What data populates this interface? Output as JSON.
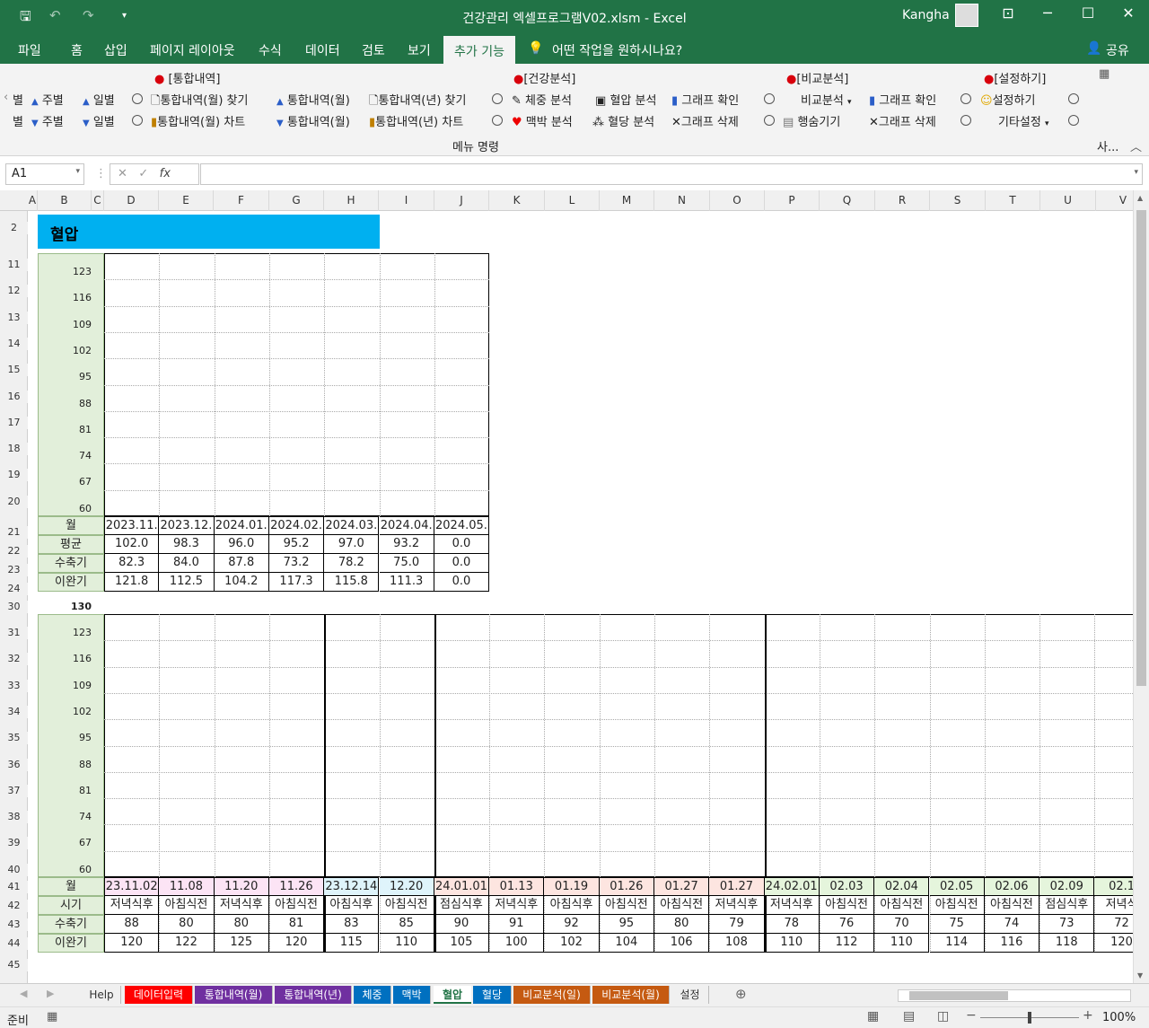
{
  "window": {
    "title": "건강관리 엑셀프로그램V02.xlsm  -  Excel",
    "user": "Kangha"
  },
  "ribbon_tabs": [
    "파일",
    "홈",
    "삽입",
    "페이지 레이아웃",
    "수식",
    "데이터",
    "검토",
    "보기",
    "추가 기능"
  ],
  "tell_me": "어떤 작업을 원하시나요?",
  "share": "공유",
  "groups": {
    "total": {
      "title": "[통합내역]",
      "week_up": "주별",
      "day_up": "일별",
      "week_dn": "주별",
      "day_dn": "일별",
      "find_month": "통합내역(월) 찾기",
      "chart_month": "통합내역(월) 차트",
      "month_up": "통합내역(월)",
      "month_dn": "통합내역(월)",
      "find_year": "통합내역(년) 찾기",
      "chart_year": "통합내역(년) 차트",
      "left_up": "별",
      "left_dn": "별"
    },
    "health": {
      "title": "[건강분석]",
      "weight": "체중 분석",
      "pulse": "맥박 분석",
      "bp": "혈압 분석",
      "sugar": "혈당 분석",
      "graph_check": "그래프 확인",
      "graph_delete": "그래프 삭제"
    },
    "compare": {
      "title": "[비교분석]",
      "compare": "비교분석",
      "hide_rows": "행숨기기",
      "graph_check": "그래프 확인",
      "graph_delete": "그래프 삭제"
    },
    "settings": {
      "title": "[설정하기]",
      "settings": "설정하기",
      "other": "기타설정"
    },
    "menu_label": "메뉴 명령",
    "collapsed": "사..."
  },
  "namebox": "A1",
  "fx": "fx",
  "columns": [
    "A",
    "B",
    "C",
    "D",
    "E",
    "F",
    "G",
    "H",
    "I",
    "J",
    "K",
    "L",
    "M",
    "N",
    "O",
    "P",
    "Q",
    "R",
    "S",
    "T",
    "U",
    "V"
  ],
  "rows": {
    "top": [
      "2",
      "11",
      "12",
      "13",
      "14",
      "15",
      "16",
      "17",
      "18",
      "19",
      "20",
      "21",
      "22",
      "23",
      "24"
    ],
    "bottom": [
      "30",
      "31",
      "32",
      "33",
      "34",
      "35",
      "36",
      "37",
      "38",
      "39",
      "40",
      "41",
      "42",
      "43",
      "44",
      "45"
    ]
  },
  "bp_title": "혈압",
  "y_axis_top": [
    "123",
    "116",
    "109",
    "102",
    "95",
    "88",
    "81",
    "74",
    "67",
    "60"
  ],
  "y_axis_bottom_header": "130",
  "y_axis_bottom": [
    "123",
    "116",
    "109",
    "102",
    "95",
    "88",
    "81",
    "74",
    "67",
    "60"
  ],
  "monthly": {
    "labels": [
      "월",
      "평균",
      "수축기",
      "이완기"
    ],
    "months": [
      "2023.11.",
      "2023.12.",
      "2024.01.",
      "2024.02.",
      "2024.03.",
      "2024.04.",
      "2024.05."
    ],
    "avg": [
      "102.0",
      "98.3",
      "96.0",
      "95.2",
      "97.0",
      "93.2",
      "0.0"
    ],
    "systolic": [
      "82.3",
      "84.0",
      "87.8",
      "73.2",
      "78.2",
      "75.0",
      "0.0"
    ],
    "diastolic": [
      "121.8",
      "112.5",
      "104.2",
      "117.3",
      "115.8",
      "111.3",
      "0.0"
    ]
  },
  "daily": {
    "labels": [
      "월",
      "시기",
      "수축기",
      "이완기"
    ],
    "dates": [
      "23.11.02",
      "11.08",
      "11.20",
      "11.26",
      "23.12.14",
      "12.20",
      "24.01.01",
      "01.13",
      "01.19",
      "01.26",
      "01.27",
      "01.27",
      "24.02.01",
      "02.03",
      "02.04",
      "02.05",
      "02.06",
      "02.09",
      "02.1"
    ],
    "times": [
      "저녁식후",
      "아침식전",
      "저녁식후",
      "아침식전",
      "아침식후",
      "아침식전",
      "점심식후",
      "저녁식후",
      "아침식후",
      "아침식전",
      "아침식전",
      "저녁식후",
      "저녁식후",
      "아침식전",
      "아침식전",
      "아침식전",
      "아침식전",
      "점심식후",
      "저녁식"
    ],
    "systolic": [
      "88",
      "80",
      "80",
      "81",
      "83",
      "85",
      "90",
      "91",
      "92",
      "95",
      "80",
      "79",
      "78",
      "76",
      "70",
      "75",
      "74",
      "73",
      "72"
    ],
    "diastolic": [
      "120",
      "122",
      "125",
      "120",
      "115",
      "110",
      "105",
      "100",
      "102",
      "104",
      "106",
      "108",
      "110",
      "112",
      "110",
      "114",
      "116",
      "118",
      "120"
    ]
  },
  "date_colors": [
    "#fce4f5",
    "#fce4f5",
    "#fce4f5",
    "#fce4f5",
    "#dff4fb",
    "#dff4fb",
    "#fde5e0",
    "#fde5e0",
    "#fde5e0",
    "#fde5e0",
    "#fde5e0",
    "#fde5e0",
    "#e5f5dc",
    "#e5f5dc",
    "#e5f5dc",
    "#e5f5dc",
    "#e5f5dc",
    "#e5f5dc",
    "#e5f5dc"
  ],
  "sheet_tabs": [
    {
      "label": "Help",
      "color": "#f0f0f0",
      "text": "#333"
    },
    {
      "label": "데이터입력",
      "color": "#ff0000",
      "text": "#fff"
    },
    {
      "label": "통합내역(월)",
      "color": "#7030a0",
      "text": "#fff"
    },
    {
      "label": "통합내역(년)",
      "color": "#7030a0",
      "text": "#fff"
    },
    {
      "label": "체중",
      "color": "#0070c0",
      "text": "#fff"
    },
    {
      "label": "맥박",
      "color": "#0070c0",
      "text": "#fff"
    },
    {
      "label": "혈압",
      "color": "#ffffff",
      "text": "#217346"
    },
    {
      "label": "혈당",
      "color": "#0070c0",
      "text": "#fff"
    },
    {
      "label": "비교분석(일)",
      "color": "#c55a11",
      "text": "#fff"
    },
    {
      "label": "비교분석(월)",
      "color": "#c55a11",
      "text": "#fff"
    },
    {
      "label": "설정",
      "color": "#f0f0f0",
      "text": "#333"
    }
  ],
  "status": {
    "ready": "준비",
    "zoom": "100%"
  }
}
